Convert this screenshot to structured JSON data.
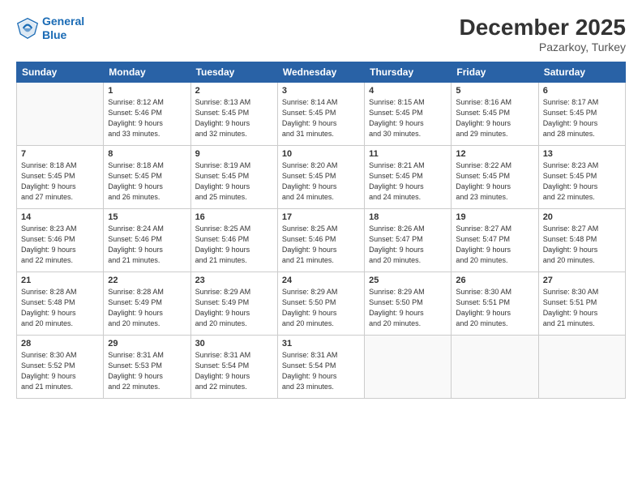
{
  "header": {
    "logo_line1": "General",
    "logo_line2": "Blue",
    "title": "December 2025",
    "subtitle": "Pazarkoy, Turkey"
  },
  "weekdays": [
    "Sunday",
    "Monday",
    "Tuesday",
    "Wednesday",
    "Thursday",
    "Friday",
    "Saturday"
  ],
  "weeks": [
    [
      {
        "day": "",
        "info": ""
      },
      {
        "day": "1",
        "info": "Sunrise: 8:12 AM\nSunset: 5:46 PM\nDaylight: 9 hours\nand 33 minutes."
      },
      {
        "day": "2",
        "info": "Sunrise: 8:13 AM\nSunset: 5:45 PM\nDaylight: 9 hours\nand 32 minutes."
      },
      {
        "day": "3",
        "info": "Sunrise: 8:14 AM\nSunset: 5:45 PM\nDaylight: 9 hours\nand 31 minutes."
      },
      {
        "day": "4",
        "info": "Sunrise: 8:15 AM\nSunset: 5:45 PM\nDaylight: 9 hours\nand 30 minutes."
      },
      {
        "day": "5",
        "info": "Sunrise: 8:16 AM\nSunset: 5:45 PM\nDaylight: 9 hours\nand 29 minutes."
      },
      {
        "day": "6",
        "info": "Sunrise: 8:17 AM\nSunset: 5:45 PM\nDaylight: 9 hours\nand 28 minutes."
      }
    ],
    [
      {
        "day": "7",
        "info": ""
      },
      {
        "day": "8",
        "info": "Sunrise: 8:18 AM\nSunset: 5:45 PM\nDaylight: 9 hours\nand 26 minutes."
      },
      {
        "day": "9",
        "info": "Sunrise: 8:19 AM\nSunset: 5:45 PM\nDaylight: 9 hours\nand 25 minutes."
      },
      {
        "day": "10",
        "info": "Sunrise: 8:20 AM\nSunset: 5:45 PM\nDaylight: 9 hours\nand 24 minutes."
      },
      {
        "day": "11",
        "info": "Sunrise: 8:21 AM\nSunset: 5:45 PM\nDaylight: 9 hours\nand 24 minutes."
      },
      {
        "day": "12",
        "info": "Sunrise: 8:22 AM\nSunset: 5:45 PM\nDaylight: 9 hours\nand 23 minutes."
      },
      {
        "day": "13",
        "info": "Sunrise: 8:23 AM\nSunset: 5:45 PM\nDaylight: 9 hours\nand 22 minutes."
      }
    ],
    [
      {
        "day": "14",
        "info": ""
      },
      {
        "day": "15",
        "info": "Sunrise: 8:24 AM\nSunset: 5:46 PM\nDaylight: 9 hours\nand 21 minutes."
      },
      {
        "day": "16",
        "info": "Sunrise: 8:25 AM\nSunset: 5:46 PM\nDaylight: 9 hours\nand 21 minutes."
      },
      {
        "day": "17",
        "info": "Sunrise: 8:25 AM\nSunset: 5:46 PM\nDaylight: 9 hours\nand 21 minutes."
      },
      {
        "day": "18",
        "info": "Sunrise: 8:26 AM\nSunset: 5:47 PM\nDaylight: 9 hours\nand 20 minutes."
      },
      {
        "day": "19",
        "info": "Sunrise: 8:27 AM\nSunset: 5:47 PM\nDaylight: 9 hours\nand 20 minutes."
      },
      {
        "day": "20",
        "info": "Sunrise: 8:27 AM\nSunset: 5:48 PM\nDaylight: 9 hours\nand 20 minutes."
      }
    ],
    [
      {
        "day": "21",
        "info": ""
      },
      {
        "day": "22",
        "info": "Sunrise: 8:28 AM\nSunset: 5:49 PM\nDaylight: 9 hours\nand 20 minutes."
      },
      {
        "day": "23",
        "info": "Sunrise: 8:29 AM\nSunset: 5:49 PM\nDaylight: 9 hours\nand 20 minutes."
      },
      {
        "day": "24",
        "info": "Sunrise: 8:29 AM\nSunset: 5:50 PM\nDaylight: 9 hours\nand 20 minutes."
      },
      {
        "day": "25",
        "info": "Sunrise: 8:29 AM\nSunset: 5:50 PM\nDaylight: 9 hours\nand 20 minutes."
      },
      {
        "day": "26",
        "info": "Sunrise: 8:30 AM\nSunset: 5:51 PM\nDaylight: 9 hours\nand 20 minutes."
      },
      {
        "day": "27",
        "info": "Sunrise: 8:30 AM\nSunset: 5:51 PM\nDaylight: 9 hours\nand 21 minutes."
      }
    ],
    [
      {
        "day": "28",
        "info": "Sunrise: 8:30 AM\nSunset: 5:52 PM\nDaylight: 9 hours\nand 21 minutes."
      },
      {
        "day": "29",
        "info": "Sunrise: 8:31 AM\nSunset: 5:53 PM\nDaylight: 9 hours\nand 22 minutes."
      },
      {
        "day": "30",
        "info": "Sunrise: 8:31 AM\nSunset: 5:54 PM\nDaylight: 9 hours\nand 22 minutes."
      },
      {
        "day": "31",
        "info": "Sunrise: 8:31 AM\nSunset: 5:54 PM\nDaylight: 9 hours\nand 23 minutes."
      },
      {
        "day": "",
        "info": ""
      },
      {
        "day": "",
        "info": ""
      },
      {
        "day": "",
        "info": ""
      }
    ]
  ],
  "week7_sunday": "Sunrise: 8:18 AM\nSunset: 5:45 PM\nDaylight: 9 hours\nand 27 minutes.",
  "week14_sunday": "Sunrise: 8:23 AM\nSunset: 5:46 PM\nDaylight: 9 hours\nand 22 minutes.",
  "week21_sunday": "Sunrise: 8:28 AM\nSunset: 5:48 PM\nDaylight: 9 hours\nand 20 minutes."
}
